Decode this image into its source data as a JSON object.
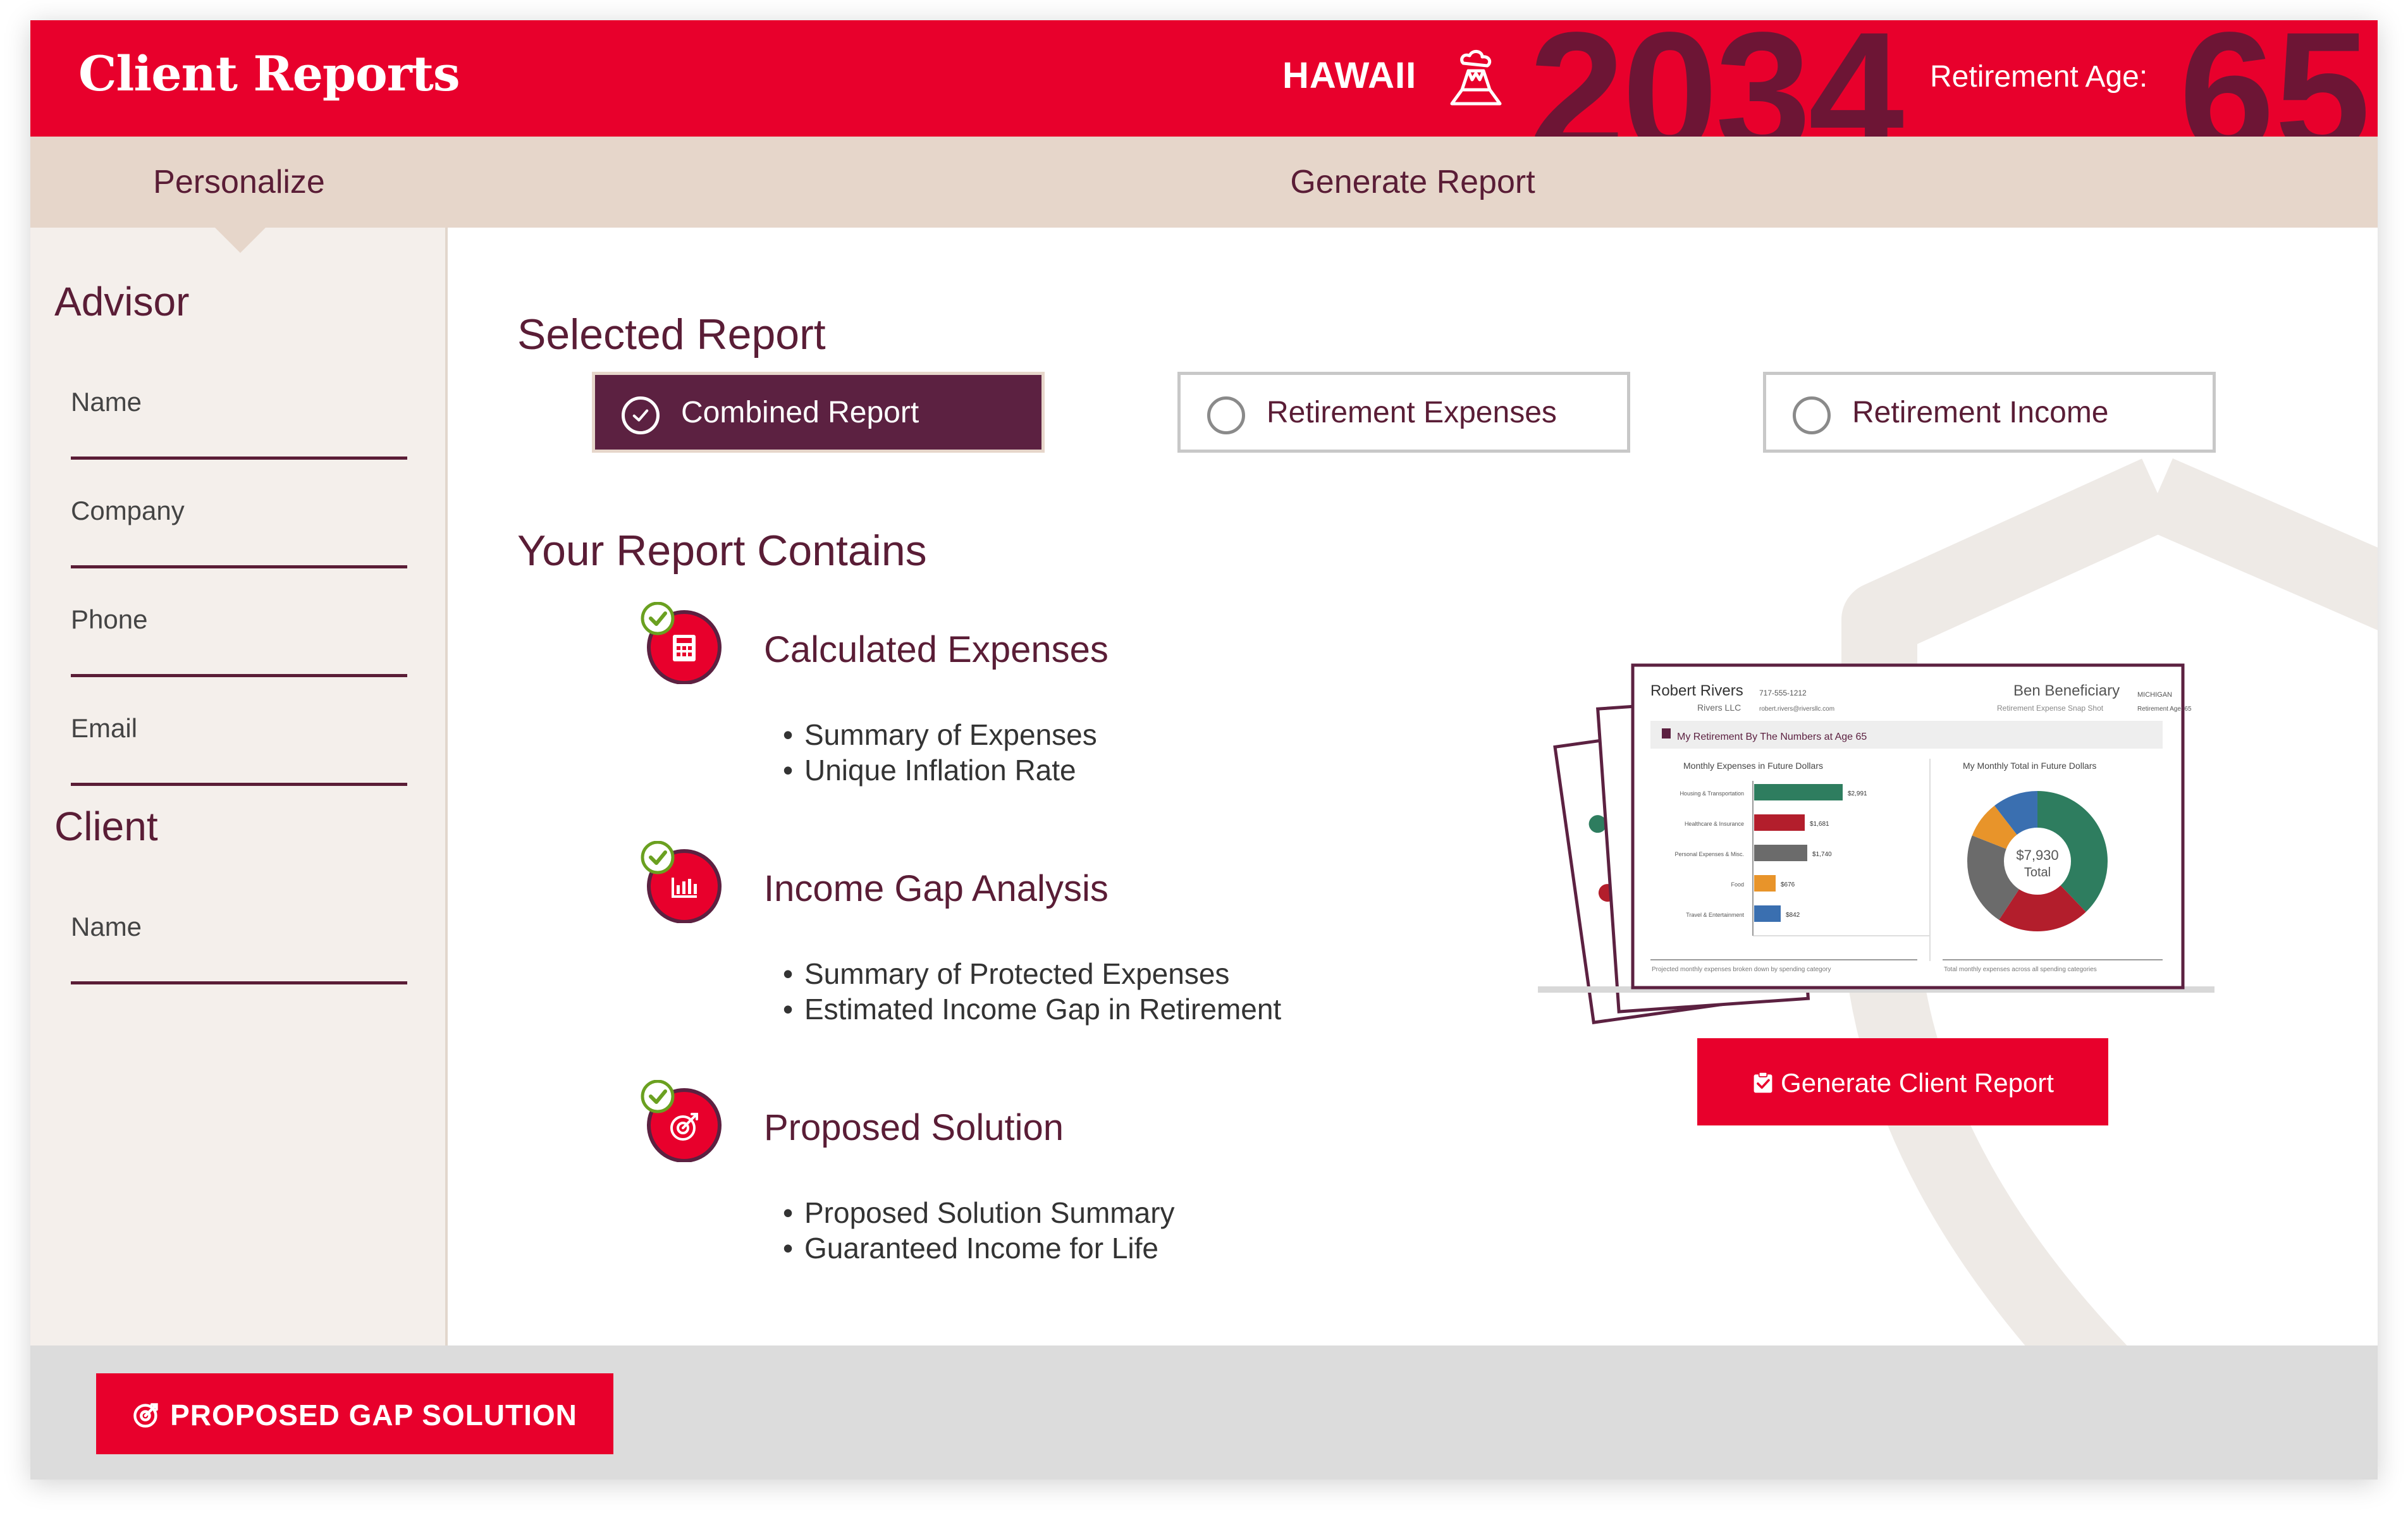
{
  "header": {
    "title": "Client Reports",
    "state": "HAWAII",
    "state_icon": "volcano-icon",
    "year": "2034",
    "retirement_age_label": "Retirement Age:",
    "retirement_age": "65",
    "colors": {
      "primary": "#e8002c",
      "accent": "#6d1535"
    }
  },
  "steps": [
    {
      "label": "Personalize"
    },
    {
      "label": "Generate Report"
    }
  ],
  "sidebar": {
    "advisor": {
      "heading": "Advisor",
      "fields": [
        {
          "label": "Name",
          "value": ""
        },
        {
          "label": "Company",
          "value": ""
        },
        {
          "label": "Phone",
          "value": ""
        },
        {
          "label": "Email",
          "value": ""
        }
      ]
    },
    "client": {
      "heading": "Client",
      "fields": [
        {
          "label": "Name",
          "value": ""
        }
      ]
    }
  },
  "main": {
    "selected_report_title": "Selected Report",
    "report_options": [
      {
        "label": "Combined Report",
        "selected": true
      },
      {
        "label": "Retirement Expenses",
        "selected": false
      },
      {
        "label": "Retirement Income",
        "selected": false
      }
    ],
    "contains_title": "Your Report Contains",
    "items": [
      {
        "title": "Calculated Expenses",
        "icon": "calculator-icon",
        "bullets": [
          "Summary of Expenses",
          "Unique Inflation Rate"
        ]
      },
      {
        "title": "Income Gap Analysis",
        "icon": "bar-chart-icon",
        "bullets": [
          "Summary of Protected Expenses",
          "Estimated Income Gap in Retirement"
        ]
      },
      {
        "title": "Proposed Solution",
        "icon": "target-icon",
        "bullets": [
          "Proposed Solution Summary",
          "Guaranteed Income for Life"
        ]
      }
    ],
    "preview": {
      "advisor_name": "Robert Rivers",
      "advisor_phone": "717-555-1212",
      "advisor_company": "Rivers LLC",
      "advisor_email": "robert.rivers@riversllc.com",
      "client_name": "Ben Beneficiary",
      "client_subtitle": "Retirement Expense Snap Shot",
      "client_state": "MICHIGAN",
      "client_age": "Retirement Age: 65",
      "banner": "My Retirement By The Numbers at Age 65",
      "left_chart_title": "Monthly Expenses in Future Dollars",
      "right_chart_title": "My Monthly Total in Future Dollars",
      "donut_total": "$7,930",
      "donut_total_label": "Total",
      "bars": [
        {
          "label": "Housing & Transportation",
          "value": "$2,991"
        },
        {
          "label": "Healthcare & Insurance",
          "value": "$1,681"
        },
        {
          "label": "Personal Expenses & Misc.",
          "value": "$1,740"
        },
        {
          "label": "Food",
          "value": "$676"
        },
        {
          "label": "Travel & Entertainment",
          "value": "$842"
        }
      ],
      "left_footnote": "Projected monthly expenses broken down by spending category",
      "right_footnote": "Total monthly expenses across all spending categories"
    },
    "generate_button": "Generate Client Report"
  },
  "footer": {
    "gap_button": "PROPOSED GAP SOLUTION"
  }
}
